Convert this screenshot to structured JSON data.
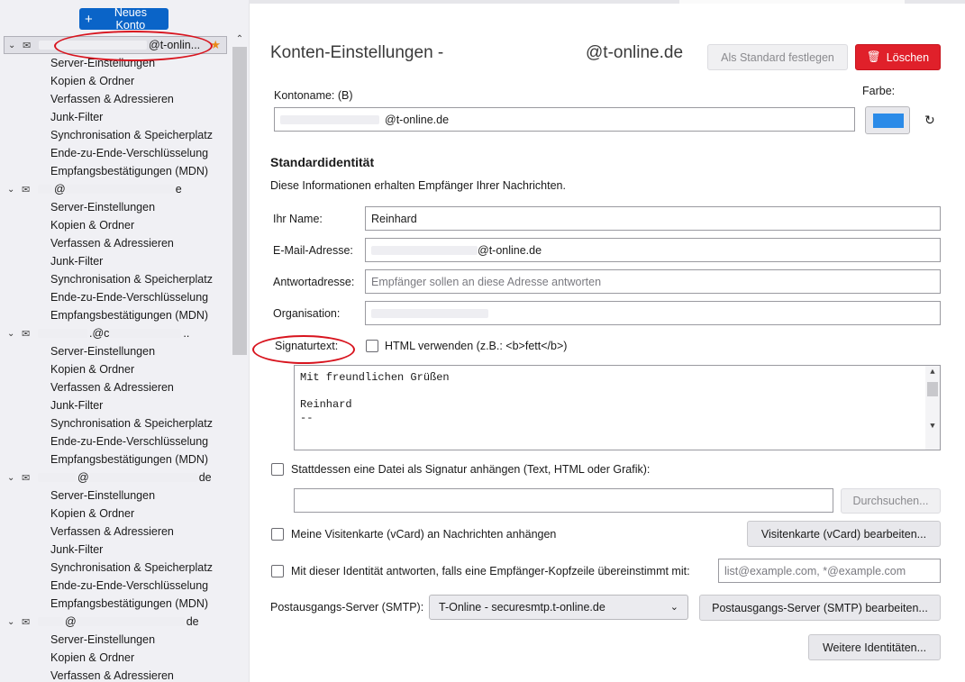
{
  "sidebar": {
    "new_account_label": "Neues Konto",
    "accounts": [
      {
        "name_visible": "@t-onlin...",
        "selected": true,
        "items": [
          "Server-Einstellungen",
          "Kopien & Ordner",
          "Verfassen & Adressieren",
          "Junk-Filter",
          "Synchronisation & Speicherplatz",
          "Ende-zu-Ende-Verschlüsselung",
          "Empfangsbestätigungen (MDN)"
        ]
      },
      {
        "name_visible": "@",
        "name_suffix": "e",
        "items": [
          "Server-Einstellungen",
          "Kopien & Ordner",
          "Verfassen & Adressieren",
          "Junk-Filter",
          "Synchronisation & Speicherplatz",
          "Ende-zu-Ende-Verschlüsselung",
          "Empfangsbestätigungen (MDN)"
        ]
      },
      {
        "name_visible": ".@c",
        "name_suffix": "..",
        "items": [
          "Server-Einstellungen",
          "Kopien & Ordner",
          "Verfassen & Adressieren",
          "Junk-Filter",
          "Synchronisation & Speicherplatz",
          "Ende-zu-Ende-Verschlüsselung",
          "Empfangsbestätigungen (MDN)"
        ]
      },
      {
        "name_visible": "@",
        "name_suffix": "de",
        "items": [
          "Server-Einstellungen",
          "Kopien & Ordner",
          "Verfassen & Adressieren",
          "Junk-Filter",
          "Synchronisation & Speicherplatz",
          "Ende-zu-Ende-Verschlüsselung",
          "Empfangsbestätigungen (MDN)"
        ]
      },
      {
        "name_visible": "@",
        "name_suffix": "de",
        "items": [
          "Server-Einstellungen",
          "Kopien & Ordner",
          "Verfassen & Adressieren"
        ]
      }
    ]
  },
  "header": {
    "title": "Konten-Einstellungen -",
    "title_domain": "@t-online.de",
    "set_default_label": "Als Standard festlegen",
    "delete_label": "Löschen"
  },
  "account_name": {
    "label": "Kontoname: (B)",
    "value": "@t-online.de",
    "color_label": "Farbe:",
    "color": "#2b8be8"
  },
  "identity": {
    "section_title": "Standardidentität",
    "description": "Diese Informationen erhalten Empfänger Ihrer Nachrichten.",
    "name_label": "Ihr Name:",
    "name_value": "Reinhard",
    "email_label": "E-Mail-Adresse:",
    "email_value": "@t-online.de",
    "reply_label": "Antwortadresse:",
    "reply_placeholder": "Empfänger sollen an diese Adresse antworten",
    "org_label": "Organisation:",
    "signature_label": "Signaturtext:",
    "html_label": "HTML verwenden (z.B.: <b>fett</b>)",
    "signature_line1": "Mit freundlichen Grüßen",
    "signature_line2": "Reinhard",
    "signature_line3": "--",
    "attach_sig_label": "Stattdessen eine Datei als Signatur anhängen (Text, HTML oder Grafik):",
    "browse_label": "Durchsuchen...",
    "vcard_label": "Meine Visitenkarte (vCard) an Nachrichten anhängen",
    "vcard_edit_label": "Visitenkarte (vCard) bearbeiten...",
    "reply_match_label": "Mit dieser Identität antworten, falls eine Empfänger-Kopfzeile übereinstimmt mit:",
    "reply_match_placeholder": "list@example.com, *@example.com",
    "smtp_label": "Postausgangs-Server (SMTP):",
    "smtp_value": "T-Online - securesmtp.t-online.de",
    "smtp_edit_label": "Postausgangs-Server (SMTP) bearbeiten...",
    "more_identities_label": "Weitere Identitäten..."
  }
}
